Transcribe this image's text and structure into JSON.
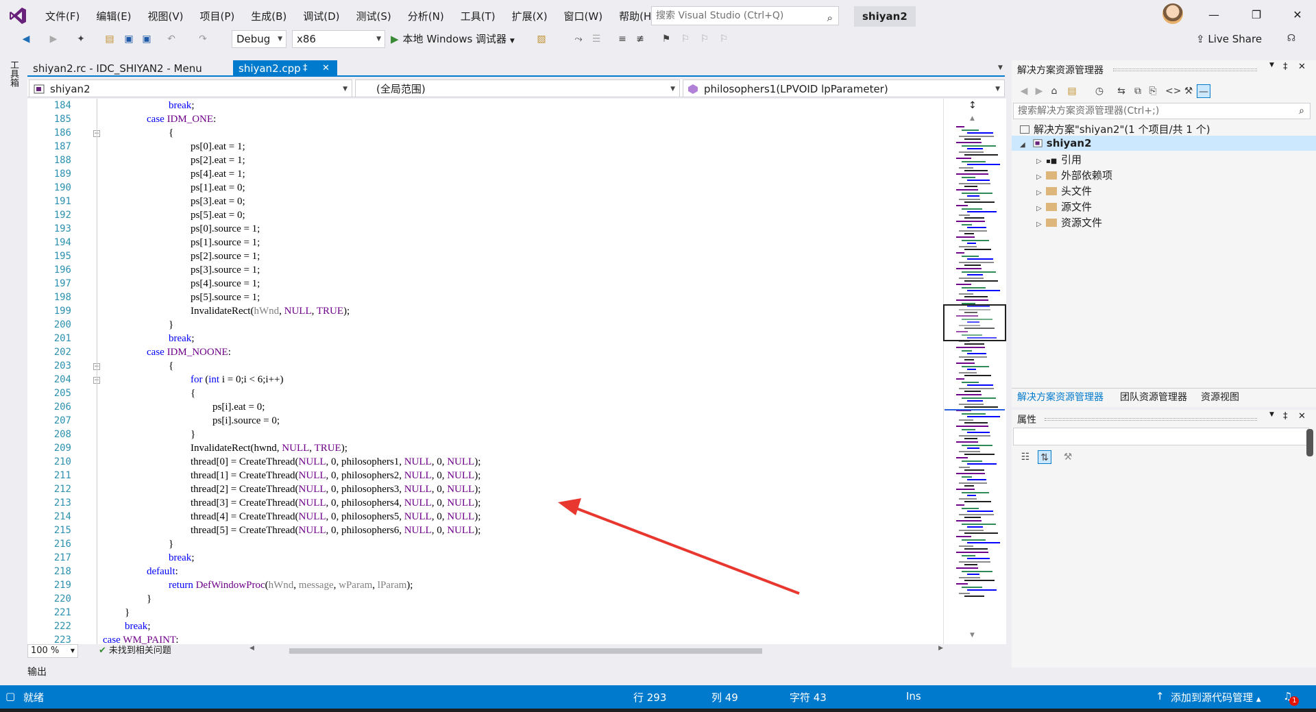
{
  "titlebar": {
    "menu": [
      "文件(F)",
      "编辑(E)",
      "视图(V)",
      "项目(P)",
      "生成(B)",
      "调试(D)",
      "测试(S)",
      "分析(N)",
      "工具(T)",
      "扩展(X)",
      "窗口(W)",
      "帮助(H)"
    ],
    "search_placeholder": "搜索 Visual Studio (Ctrl+Q)",
    "solution_name": "shiyan2"
  },
  "toolbar": {
    "config": "Debug",
    "platform": "x86",
    "run_label": "本地 Windows 调试器",
    "live_share": "Live Share"
  },
  "left_strip": {
    "toolbox": "工具箱"
  },
  "tabs": [
    {
      "label": "shiyan2.rc - IDC_SHIYAN2 - Menu"
    },
    {
      "label": "shiyan2.cpp"
    }
  ],
  "navbar": {
    "project": "shiyan2",
    "scope": "(全局范围)",
    "function": "philosophers1(LPVOID lpParameter)"
  },
  "code": {
    "lines": [
      {
        "n": "184",
        "indent": 4,
        "tokens": [
          [
            "kw",
            "break"
          ],
          [
            "p",
            ";"
          ]
        ]
      },
      {
        "n": "185",
        "indent": 3,
        "tokens": [
          [
            "kw",
            "case"
          ],
          [
            "p",
            " "
          ],
          [
            "mac",
            "IDM_ONE"
          ],
          [
            "p",
            ":"
          ]
        ]
      },
      {
        "n": "186",
        "indent": 4,
        "tokens": [
          [
            "p",
            "{"
          ]
        ]
      },
      {
        "n": "187",
        "indent": 5,
        "tokens": [
          [
            "p",
            "ps[0].eat = 1;"
          ]
        ]
      },
      {
        "n": "188",
        "indent": 5,
        "tokens": [
          [
            "p",
            "ps[2].eat = 1;"
          ]
        ]
      },
      {
        "n": "189",
        "indent": 5,
        "tokens": [
          [
            "p",
            "ps[4].eat = 1;"
          ]
        ]
      },
      {
        "n": "190",
        "indent": 5,
        "tokens": [
          [
            "p",
            "ps[1].eat = 0;"
          ]
        ]
      },
      {
        "n": "191",
        "indent": 5,
        "tokens": [
          [
            "p",
            "ps[3].eat = 0;"
          ]
        ]
      },
      {
        "n": "192",
        "indent": 5,
        "tokens": [
          [
            "p",
            "ps[5].eat = 0;"
          ]
        ]
      },
      {
        "n": "193",
        "indent": 5,
        "tokens": [
          [
            "p",
            "ps[0].source = 1;"
          ]
        ]
      },
      {
        "n": "194",
        "indent": 5,
        "tokens": [
          [
            "p",
            "ps[1].source = 1;"
          ]
        ]
      },
      {
        "n": "195",
        "indent": 5,
        "tokens": [
          [
            "p",
            "ps[2].source = 1;"
          ]
        ]
      },
      {
        "n": "196",
        "indent": 5,
        "tokens": [
          [
            "p",
            "ps[3].source = 1;"
          ]
        ]
      },
      {
        "n": "197",
        "indent": 5,
        "tokens": [
          [
            "p",
            "ps[4].source = 1;"
          ]
        ]
      },
      {
        "n": "198",
        "indent": 5,
        "tokens": [
          [
            "p",
            "ps[5].source = 1;"
          ]
        ]
      },
      {
        "n": "199",
        "indent": 5,
        "tokens": [
          [
            "p",
            "InvalidateRect("
          ],
          [
            "param",
            "hWnd"
          ],
          [
            "p",
            ", "
          ],
          [
            "mac",
            "NULL"
          ],
          [
            "p",
            ", "
          ],
          [
            "mac",
            "TRUE"
          ],
          [
            "p",
            ");"
          ]
        ]
      },
      {
        "n": "200",
        "indent": 4,
        "tokens": [
          [
            "p",
            "}"
          ]
        ]
      },
      {
        "n": "201",
        "indent": 4,
        "tokens": [
          [
            "kw",
            "break"
          ],
          [
            "p",
            ";"
          ]
        ]
      },
      {
        "n": "202",
        "indent": 3,
        "tokens": [
          [
            "kw",
            "case"
          ],
          [
            "p",
            " "
          ],
          [
            "mac",
            "IDM_NOONE"
          ],
          [
            "p",
            ":"
          ]
        ]
      },
      {
        "n": "203",
        "indent": 4,
        "tokens": [
          [
            "p",
            "{"
          ]
        ]
      },
      {
        "n": "204",
        "indent": 5,
        "tokens": [
          [
            "kw",
            "for"
          ],
          [
            "p",
            " ("
          ],
          [
            "kw",
            "int"
          ],
          [
            "p",
            " i = 0;i < 6;i++)"
          ]
        ]
      },
      {
        "n": "205",
        "indent": 5,
        "tokens": [
          [
            "p",
            "{"
          ]
        ]
      },
      {
        "n": "206",
        "indent": 6,
        "tokens": [
          [
            "p",
            "ps[i].eat = 0;"
          ]
        ]
      },
      {
        "n": "207",
        "indent": 6,
        "tokens": [
          [
            "p",
            "ps[i].source = 0;"
          ]
        ]
      },
      {
        "n": "208",
        "indent": 5,
        "tokens": [
          [
            "p",
            "}"
          ]
        ]
      },
      {
        "n": "209",
        "indent": 5,
        "tokens": [
          [
            "p",
            "InvalidateRect(hwnd, "
          ],
          [
            "mac",
            "NULL"
          ],
          [
            "p",
            ", "
          ],
          [
            "mac",
            "TRUE"
          ],
          [
            "p",
            ");"
          ]
        ]
      },
      {
        "n": "210",
        "indent": 5,
        "tokens": [
          [
            "p",
            "thread[0] = CreateThread("
          ],
          [
            "mac",
            "NULL"
          ],
          [
            "p",
            ", 0, philosophers1, "
          ],
          [
            "mac",
            "NULL"
          ],
          [
            "p",
            ", 0, "
          ],
          [
            "mac",
            "NULL"
          ],
          [
            "p",
            ");"
          ]
        ]
      },
      {
        "n": "211",
        "indent": 5,
        "tokens": [
          [
            "p",
            "thread[1] = CreateThread("
          ],
          [
            "mac",
            "NULL"
          ],
          [
            "p",
            ", 0, philosophers2, "
          ],
          [
            "mac",
            "NULL"
          ],
          [
            "p",
            ", 0, "
          ],
          [
            "mac",
            "NULL"
          ],
          [
            "p",
            ");"
          ]
        ]
      },
      {
        "n": "212",
        "indent": 5,
        "tokens": [
          [
            "p",
            "thread[2] = CreateThread("
          ],
          [
            "mac",
            "NULL"
          ],
          [
            "p",
            ", 0, philosophers3, "
          ],
          [
            "mac",
            "NULL"
          ],
          [
            "p",
            ", 0, "
          ],
          [
            "mac",
            "NULL"
          ],
          [
            "p",
            ");"
          ]
        ]
      },
      {
        "n": "213",
        "indent": 5,
        "tokens": [
          [
            "p",
            "thread[3] = CreateThread("
          ],
          [
            "mac",
            "NULL"
          ],
          [
            "p",
            ", 0, philosophers4, "
          ],
          [
            "mac",
            "NULL"
          ],
          [
            "p",
            ", 0, "
          ],
          [
            "mac",
            "NULL"
          ],
          [
            "p",
            ");"
          ]
        ]
      },
      {
        "n": "214",
        "indent": 5,
        "tokens": [
          [
            "p",
            "thread[4] = CreateThread("
          ],
          [
            "mac",
            "NULL"
          ],
          [
            "p",
            ", 0, philosophers5, "
          ],
          [
            "mac",
            "NULL"
          ],
          [
            "p",
            ", 0, "
          ],
          [
            "mac",
            "NULL"
          ],
          [
            "p",
            ");"
          ]
        ]
      },
      {
        "n": "215",
        "indent": 5,
        "tokens": [
          [
            "p",
            "thread[5] = CreateThread("
          ],
          [
            "mac",
            "NULL"
          ],
          [
            "p",
            ", 0, philosophers6, "
          ],
          [
            "mac",
            "NULL"
          ],
          [
            "p",
            ", 0, "
          ],
          [
            "mac",
            "NULL"
          ],
          [
            "p",
            ");"
          ]
        ]
      },
      {
        "n": "216",
        "indent": 4,
        "tokens": [
          [
            "p",
            "}"
          ]
        ]
      },
      {
        "n": "217",
        "indent": 4,
        "tokens": [
          [
            "kw",
            "break"
          ],
          [
            "p",
            ";"
          ]
        ]
      },
      {
        "n": "218",
        "indent": 3,
        "tokens": [
          [
            "kw",
            "default"
          ],
          [
            "p",
            ":"
          ]
        ]
      },
      {
        "n": "219",
        "indent": 4,
        "tokens": [
          [
            "kw",
            "return"
          ],
          [
            "p",
            " "
          ],
          [
            "mac",
            "DefWindowProc"
          ],
          [
            "p",
            "("
          ],
          [
            "param",
            "hWnd"
          ],
          [
            "p",
            ", "
          ],
          [
            "param",
            "message"
          ],
          [
            "p",
            ", "
          ],
          [
            "param",
            "wParam"
          ],
          [
            "p",
            ", "
          ],
          [
            "param",
            "lParam"
          ],
          [
            "p",
            ");"
          ]
        ]
      },
      {
        "n": "220",
        "indent": 3,
        "tokens": [
          [
            "p",
            "}"
          ]
        ]
      },
      {
        "n": "221",
        "indent": 2,
        "tokens": [
          [
            "p",
            "}"
          ]
        ]
      },
      {
        "n": "222",
        "indent": 2,
        "tokens": [
          [
            "kw",
            "break"
          ],
          [
            "p",
            ";"
          ]
        ]
      },
      {
        "n": "223",
        "indent": 1,
        "tokens": [
          [
            "kw",
            "case"
          ],
          [
            "p",
            " "
          ],
          [
            "mac",
            "WM_PAINT"
          ],
          [
            "p",
            ":"
          ]
        ]
      }
    ]
  },
  "editor_status": {
    "zoom": "100 %",
    "issues": "未找到相关问题"
  },
  "output_tab": "输出",
  "solution_explorer": {
    "title": "解决方案资源管理器",
    "search_placeholder": "搜索解决方案资源管理器(Ctrl+;)",
    "solution": "解决方案\"shiyan2\"(1 个项目/共 1 个)",
    "project": "shiyan2",
    "nodes": [
      "引用",
      "外部依赖项",
      "头文件",
      "源文件",
      "资源文件"
    ],
    "bottom_tabs": [
      "解决方案资源管理器",
      "团队资源管理器",
      "资源视图"
    ]
  },
  "properties": {
    "title": "属性"
  },
  "statusbar": {
    "ready": "就绪",
    "row": "行 293",
    "col": "列 49",
    "char": "字符 43",
    "ins": "Ins",
    "source_control": "添加到源代码管理",
    "notifications": "1"
  },
  "colors": {
    "accent": "#007acc",
    "keyword": "#0000ff",
    "macro": "#6f008a",
    "param": "#808080",
    "annotation_arrow": "#e8372f"
  }
}
